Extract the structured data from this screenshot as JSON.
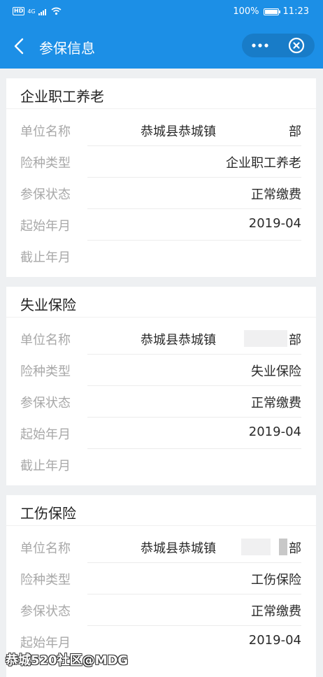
{
  "status_bar": {
    "network_badge": "HD",
    "network_type": "4G",
    "battery_percent": "100%",
    "battery_level": 1.0,
    "time": "11:23"
  },
  "nav": {
    "title": "参保信息",
    "more_icon": "more-icon",
    "close_icon": "close-circle-icon",
    "back_icon": "chevron-left-icon"
  },
  "colors": {
    "nav_bg": "#1c8fe6",
    "page_bg": "#eef0f2",
    "label": "#a8a8a8",
    "value": "#2a2a2a"
  },
  "cards": [
    {
      "title": "企业职工养老",
      "rows": [
        {
          "label": "单位名称",
          "value_left": "恭城县恭城镇",
          "value_right": "部"
        },
        {
          "label": "险种类型",
          "value": "企业职工养老"
        },
        {
          "label": "参保状态",
          "value": "正常缴费"
        },
        {
          "label": "起始年月",
          "value": "2019-04"
        },
        {
          "label": "截止年月",
          "value": ""
        }
      ]
    },
    {
      "title": "失业保险",
      "rows": [
        {
          "label": "单位名称",
          "value_left": "恭城县恭城镇",
          "value_right": "部"
        },
        {
          "label": "险种类型",
          "value": "失业保险"
        },
        {
          "label": "参保状态",
          "value": "正常缴费"
        },
        {
          "label": "起始年月",
          "value": "2019-04"
        },
        {
          "label": "截止年月",
          "value": ""
        }
      ]
    },
    {
      "title": "工伤保险",
      "rows": [
        {
          "label": "单位名称",
          "value_left": "恭城县恭城镇",
          "value_right": "部"
        },
        {
          "label": "险种类型",
          "value": "工伤保险"
        },
        {
          "label": "参保状态",
          "value": "正常缴费"
        },
        {
          "label": "起始年月",
          "value": "2019-04"
        }
      ]
    }
  ],
  "watermark": "恭城520社区@MDG"
}
